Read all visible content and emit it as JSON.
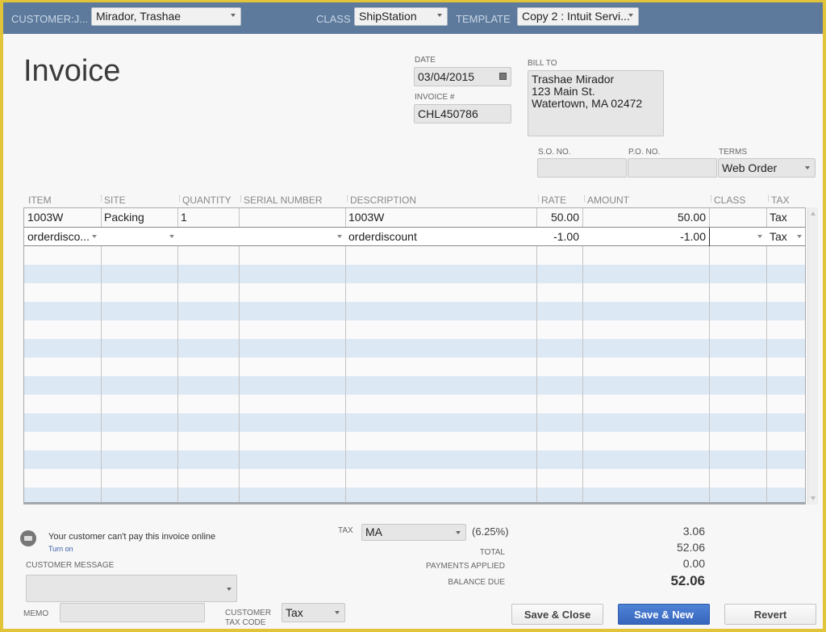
{
  "topbar": {
    "customer_label": "CUSTOMER:J...",
    "customer_value": "Mirador, Trashae",
    "class_label": "CLASS",
    "class_value": "ShipStation",
    "template_label": "TEMPLATE",
    "template_value": "Copy 2 : Intuit Servi..."
  },
  "header": {
    "title": "Invoice",
    "date_label": "DATE",
    "date_value": "03/04/2015",
    "invoice_label": "INVOICE #",
    "invoice_value": "CHL450786",
    "billto_label": "BILL TO",
    "billto_lines": [
      "Trashae Mirador",
      "123 Main St.",
      "Watertown, MA  02472"
    ],
    "so_label": "S.O. NO.",
    "so_value": "",
    "po_label": "P.O. NO.",
    "po_value": "",
    "terms_label": "TERMS",
    "terms_value": "Web Order"
  },
  "grid": {
    "columns": [
      "ITEM",
      "SITE",
      "QUANTITY",
      "SERIAL NUMBER",
      "DESCRIPTION",
      "RATE",
      "AMOUNT",
      "CLASS",
      "TAX"
    ],
    "rows": [
      {
        "item": "1003W",
        "site": "Packing",
        "quantity": "1",
        "serial": "",
        "description": "1003W",
        "rate": "50.00",
        "amount": "50.00",
        "class": "",
        "tax": "Tax"
      },
      {
        "item": "orderdisco...",
        "site": "",
        "quantity": "",
        "serial": "",
        "description": "orderdiscount",
        "rate": "-1.00",
        "amount": "-1.00",
        "class": "",
        "tax": "Tax"
      }
    ]
  },
  "footer": {
    "pay_online_text": "Your customer can't pay this invoice online",
    "turn_on_link": "Turn on",
    "customer_message_label": "CUSTOMER MESSAGE",
    "customer_message_value": "",
    "memo_label": "MEMO",
    "memo_value": "",
    "customer_tax_code_label_1": "CUSTOMER",
    "customer_tax_code_label_2": "TAX CODE",
    "customer_tax_code_value": "Tax",
    "tax_label": "TAX",
    "tax_value": "MA",
    "tax_rate": "(6.25%)",
    "tax_amount": "3.06",
    "total_label": "TOTAL",
    "total_value": "52.06",
    "payments_label": "PAYMENTS APPLIED",
    "payments_value": "0.00",
    "balance_label": "BALANCE DUE",
    "balance_value": "52.06"
  },
  "buttons": {
    "save_close": "Save & Close",
    "save_new": "Save & New",
    "revert": "Revert"
  }
}
